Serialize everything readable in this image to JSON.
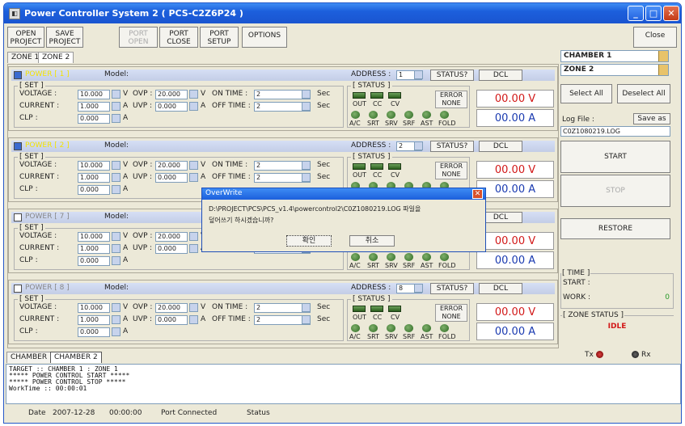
{
  "window": {
    "title": "Power Controller System 2 ( PCS-C2Z6P24 )"
  },
  "toolbar": {
    "open_project": "OPEN\nPROJECT",
    "save_project": "SAVE\nPROJECT",
    "port_open": "PORT\nOPEN",
    "port_close": "PORT\nCLOSE",
    "port_setup": "PORT\nSETUP",
    "options": "OPTIONS",
    "close": "Close"
  },
  "zone_tabs": [
    "ZONE 1",
    "ZONE 2"
  ],
  "labels": {
    "model": "Model:",
    "address": "ADDRESS :",
    "status_btn": "STATUS?",
    "dcl": "DCL",
    "set": "[ SET ]",
    "status": "[ STATUS ]",
    "voltage": "VOLTAGE :",
    "current": "CURRENT :",
    "clp": "CLP :",
    "ovp": "OVP :",
    "uvp": "UVP :",
    "on_time": "ON TIME :",
    "off_time": "OFF TIME :",
    "v": "V",
    "a": "A",
    "sec": "Sec",
    "error": "ERROR",
    "out": "OUT",
    "cc": "CC",
    "cv": "CV",
    "avc": "A/C",
    "srt": "SRT",
    "srv": "SRV",
    "srf": "SRF",
    "ast": "AST",
    "fold": "FOLD"
  },
  "powers": [
    {
      "name": "POWER [ 1 ]",
      "checked": true,
      "address": "1",
      "voltage": "10.000",
      "current": "1.000",
      "clp": "0.000",
      "ovp": "20.000",
      "uvp": "0.000",
      "on_time": "2",
      "off_time": "2",
      "error": "NONE",
      "volt_reading": "00.00 V",
      "amp_reading": "00.00 A"
    },
    {
      "name": "POWER [ 2 ]",
      "checked": true,
      "address": "2",
      "voltage": "10.000",
      "current": "1.000",
      "clp": "0.000",
      "ovp": "20.000",
      "uvp": "0.000",
      "on_time": "2",
      "off_time": "2",
      "error": "NONE",
      "volt_reading": "00.00 V",
      "amp_reading": "00.00 A"
    },
    {
      "name": "POWER [ 7 ]",
      "checked": false,
      "address": "",
      "voltage": "10.000",
      "current": "1.000",
      "clp": "0.000",
      "ovp": "20.000",
      "uvp": "0.000",
      "on_time": "",
      "off_time": "",
      "error": "",
      "volt_reading": "00.00 V",
      "amp_reading": "00.00 A"
    },
    {
      "name": "POWER [ 8 ]",
      "checked": false,
      "address": "8",
      "voltage": "10.000",
      "current": "1.000",
      "clp": "0.000",
      "ovp": "20.000",
      "uvp": "0.000",
      "on_time": "2",
      "off_time": "2",
      "error": "NONE",
      "volt_reading": "00.00 V",
      "amp_reading": "00.00 A"
    }
  ],
  "right": {
    "chamber": "CHAMBER 1",
    "zone": "ZONE 2",
    "select_all": "Select All",
    "deselect_all": "Deselect All",
    "log_file": "Log File :",
    "save_as": "Save as",
    "log_filename": "C0Z1080219.LOG",
    "start": "START",
    "stop": "STOP",
    "restore": "RESTORE",
    "time_group": "[ TIME ]",
    "start_label": "START :",
    "work_label": "WORK :",
    "work_value": "0",
    "zone_status_group": "[ ZONE STATUS ]",
    "zone_status": "IDLE",
    "tx": "Tx",
    "rx": "Rx"
  },
  "chamber_tabs": [
    "CHAMBER 1",
    "CHAMBER 2"
  ],
  "log_lines": [
    "TARGET :: CHAMBER 1 : ZONE 1",
    "***** POWER CONTROL START *****",
    "***** POWER CONTROL STOP *****",
    "WorkTime :: 00:00:01"
  ],
  "statusbar": {
    "date_label": "Date",
    "date_value": "2007-12-28",
    "time_value": "00:00:00",
    "port": "Port Connected",
    "status": "Status"
  },
  "dialog": {
    "title": "OverWrite",
    "message_line1": "D:\\PROJECT\\PCS\\PCS_v1.4\\powercontrol2\\C0Z1080219.LOG 파일을",
    "message_line2": "덮어쓰기 하시겠습니까?",
    "ok": "확인",
    "cancel": "취소"
  },
  "colors": {
    "titlebar": "#1c5fdc",
    "reading_red": "#d21818",
    "reading_blue": "#1a3ab0",
    "active_power": "#f4e300",
    "idle": "#d21818"
  }
}
